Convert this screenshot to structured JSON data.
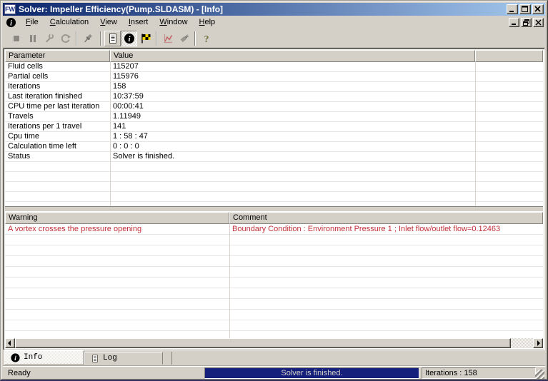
{
  "window": {
    "title": "Solver: Impeller Efficiency(Pump.SLDASM) - [Info]",
    "app_icon_text": "FW",
    "title_buttons": [
      "minimize",
      "maximize",
      "close"
    ],
    "child_buttons": [
      "minimize",
      "restore",
      "close"
    ]
  },
  "menu": {
    "items": [
      "File",
      "Calculation",
      "View",
      "Insert",
      "Window",
      "Help"
    ]
  },
  "toolbar": {
    "buttons": [
      {
        "icon": "stop-icon",
        "state": "disabled"
      },
      {
        "icon": "pause-icon",
        "state": "disabled"
      },
      {
        "icon": "wrench-icon",
        "state": "disabled"
      },
      {
        "icon": "refresh-icon",
        "state": "disabled"
      },
      {
        "icon": "pushpin-icon",
        "state": "normal"
      },
      {
        "icon": "document-icon",
        "state": "raised"
      },
      {
        "icon": "info-icon",
        "state": "pressed"
      },
      {
        "icon": "checkered-flag-icon",
        "state": "normal"
      },
      {
        "icon": "chart-icon",
        "state": "disabled"
      },
      {
        "icon": "plug-icon",
        "state": "disabled"
      },
      {
        "icon": "question-mark-icon",
        "state": "normal"
      }
    ]
  },
  "params_table": {
    "headers": [
      "Parameter",
      "Value",
      ""
    ],
    "rows": [
      {
        "name": "Fluid cells",
        "value": "115207"
      },
      {
        "name": "Partial cells",
        "value": "115976"
      },
      {
        "name": "Iterations",
        "value": "158"
      },
      {
        "name": "Last iteration finished",
        "value": "10:37:59"
      },
      {
        "name": "CPU time per last iteration",
        "value": "00:00:41"
      },
      {
        "name": "Travels",
        "value": "1.11949"
      },
      {
        "name": "Iterations per 1 travel",
        "value": "141"
      },
      {
        "name": "Cpu time",
        "value": "1 : 58 : 47"
      },
      {
        "name": "Calculation time left",
        "value": "0 : 0 : 0"
      },
      {
        "name": "Status",
        "value": "Solver is finished."
      }
    ]
  },
  "warnings_table": {
    "headers": [
      "Warning",
      "Comment"
    ],
    "rows": [
      {
        "warning": "A vortex crosses the pressure opening",
        "comment": "Boundary Condition : Environment Pressure 1 ; Inlet flow/outlet flow=0.12463"
      }
    ]
  },
  "tabs": {
    "info_label": "Info",
    "log_label": "Log"
  },
  "statusbar": {
    "ready": "Ready",
    "progress_text": "Solver is finished.",
    "iterations": "Iterations : 158"
  },
  "colors": {
    "warning_text": "#c03038",
    "progress_bg": "#14207b",
    "title_grad_start": "#0a246a",
    "title_grad_end": "#a6caf0"
  }
}
